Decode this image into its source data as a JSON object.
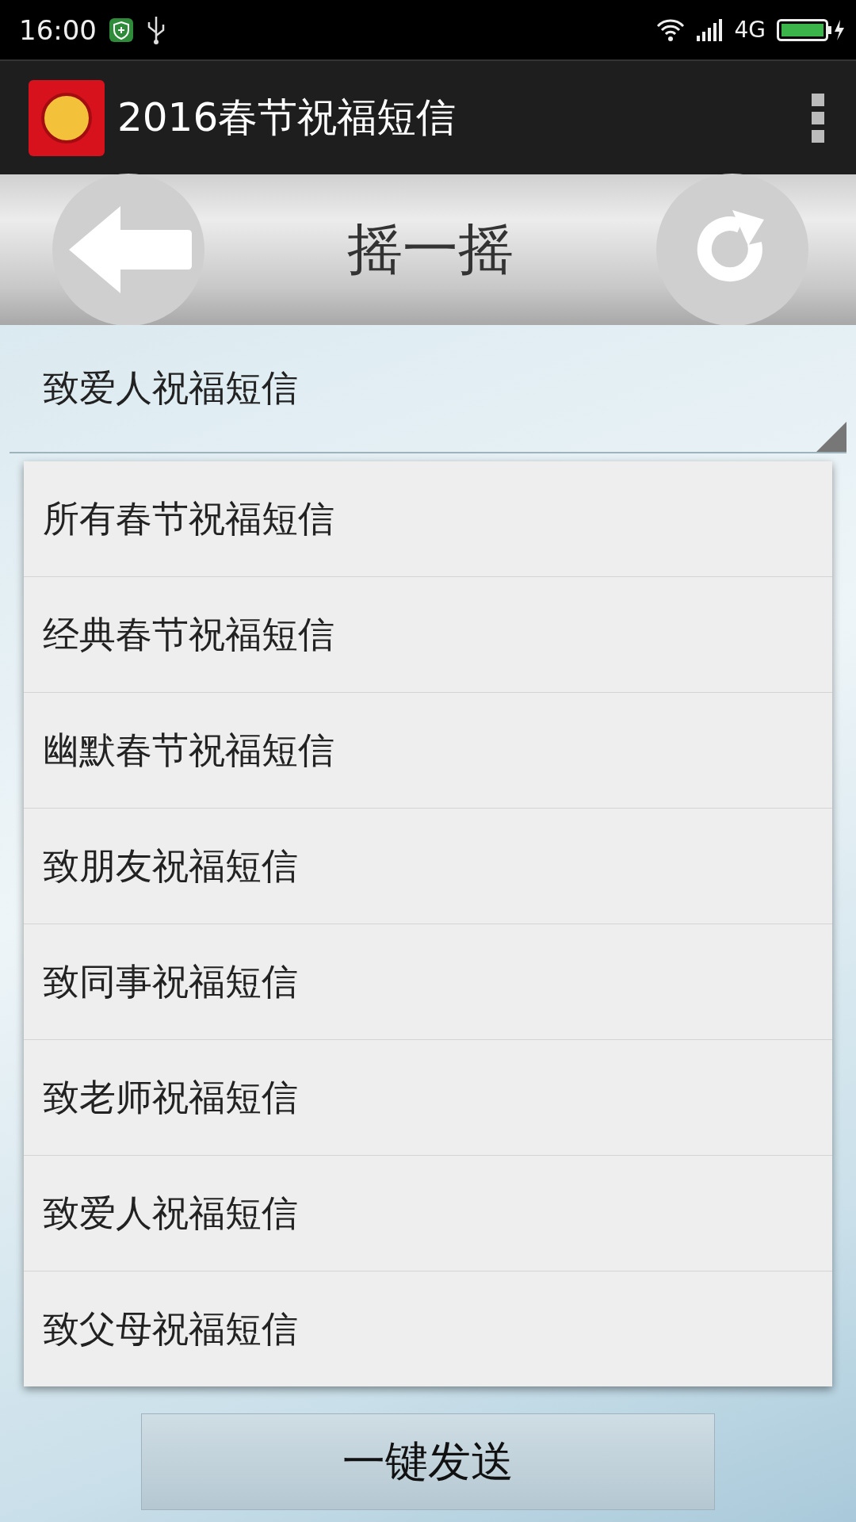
{
  "status_bar": {
    "time": "16:00",
    "network": "4G"
  },
  "app_bar": {
    "title": "2016春节祝福短信"
  },
  "toolbar": {
    "title": "摇一摇"
  },
  "spinner": {
    "value": "致爱人祝福短信"
  },
  "dropdown": {
    "items": [
      {
        "label": "所有春节祝福短信"
      },
      {
        "label": "经典春节祝福短信"
      },
      {
        "label": "幽默春节祝福短信"
      },
      {
        "label": "致朋友祝福短信"
      },
      {
        "label": "致同事祝福短信"
      },
      {
        "label": "致老师祝福短信"
      },
      {
        "label": "致爱人祝福短信"
      },
      {
        "label": "致父母祝福短信"
      }
    ]
  },
  "send_button": {
    "label": "一键发送"
  }
}
